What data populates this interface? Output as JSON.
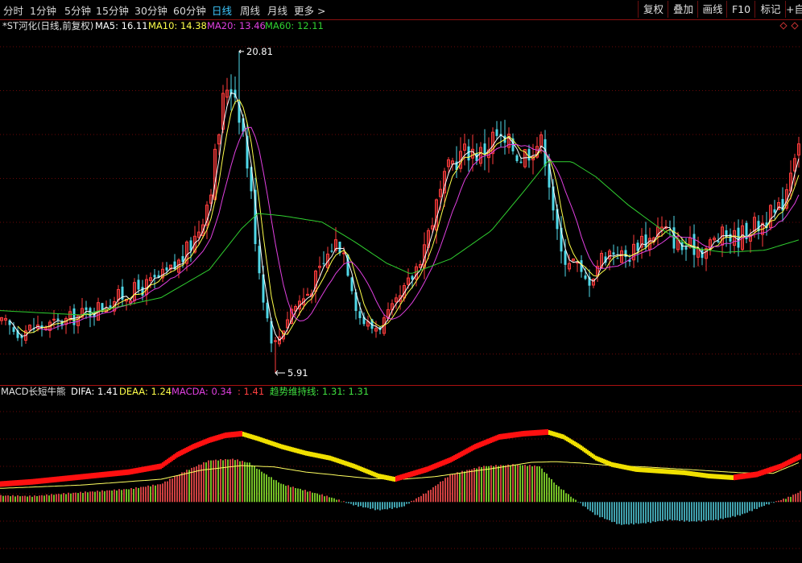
{
  "toolbar": {
    "periods": [
      "分时",
      "1分钟",
      "5分钟",
      "15分钟",
      "30分钟",
      "60分钟",
      "日线",
      "周线",
      "月线",
      "更多 >"
    ],
    "active_period": "日线",
    "buttons": [
      "复权",
      "叠加",
      "画线",
      "F10",
      "标记",
      "+自选"
    ]
  },
  "main_legend": {
    "stock": "*ST河化(日线,前复权)",
    "ma5": "MA5: 16.11",
    "ma10": "MA10: 14.38",
    "ma20": "MA20: 13.46",
    "ma60": "MA60: 12.11"
  },
  "annotations": {
    "high": "20.81",
    "low": "5.91"
  },
  "macd_legend": {
    "name": "MACD长短牛熊",
    "difa": "DIFA: 1.41",
    "deaa": "DEAA: 1.24",
    "macda": "MACDA: 0.34",
    "extra": ": 1.41",
    "trend": "趋势维持线: 1.31",
    "trend2": ": 1.31"
  },
  "colors": {
    "up": "#ff3c3c",
    "down": "#50d8e8",
    "ma5": "#ffffff",
    "ma10": "#ffff4a",
    "ma20": "#e040e0",
    "ma60": "#30d030",
    "macd_pos_up": "#ff5050",
    "macd_pos_down": "#90ee30",
    "macd_neg": "#50c8d8",
    "dif_up": "#ff1010",
    "dif_down": "#f0e000",
    "trend": "#ffff60"
  },
  "chart_data": [
    {
      "type": "candlestick",
      "title": "*ST河化(日线,前复权)",
      "ylim": [
        5.5,
        22.0
      ],
      "annotations": [
        {
          "label": "20.81",
          "value": 20.81
        },
        {
          "label": "5.91",
          "value": 5.91
        }
      ],
      "close_path_x": [
        0,
        10,
        20,
        40,
        60,
        80,
        100,
        120,
        140,
        160,
        180,
        200,
        215,
        230,
        245,
        260,
        270,
        280,
        290,
        300,
        310,
        320,
        330,
        340,
        350,
        360,
        380,
        400,
        415,
        425,
        435,
        445,
        460,
        470,
        480,
        490,
        500,
        515,
        530,
        545,
        560,
        575,
        585,
        595,
        605,
        615,
        625,
        635,
        645,
        655,
        665,
        675,
        685,
        695,
        705,
        715,
        725,
        735,
        745,
        755,
        765,
        775,
        785,
        795,
        805,
        815,
        825,
        835,
        845,
        855,
        865,
        875,
        885,
        895,
        905,
        915,
        925,
        935,
        945,
        955,
        965,
        975,
        985,
        995
      ],
      "close_path_y": [
        8.2,
        8.1,
        7.8,
        8.0,
        8.1,
        8.3,
        8.6,
        8.9,
        9.3,
        9.6,
        9.9,
        10.3,
        10.7,
        11.4,
        12.4,
        14.2,
        16.6,
        19.3,
        19.2,
        17.6,
        14.8,
        11.2,
        8.8,
        7.1,
        7.9,
        8.8,
        9.5,
        10.8,
        12.0,
        11.8,
        10.4,
        8.6,
        8.0,
        8.1,
        8.4,
        8.9,
        9.5,
        10.6,
        12.2,
        14.0,
        15.6,
        16.1,
        16.3,
        16.0,
        16.4,
        17.0,
        16.4,
        16.5,
        15.9,
        16.2,
        16.6,
        16.5,
        14.2,
        11.4,
        11.3,
        11.0,
        10.1,
        10.4,
        11.2,
        11.5,
        11.6,
        11.2,
        11.5,
        12.2,
        12.0,
        12.6,
        12.5,
        12.2,
        11.7,
        11.7,
        11.8,
        11.6,
        12.0,
        12.2,
        12.3,
        12.1,
        12.5,
        12.7,
        12.8,
        13.2,
        13.2,
        14.2,
        16.1,
        17.2
      ],
      "ma60_x": [
        0,
        100,
        200,
        260,
        300,
        320,
        350,
        400,
        440,
        480,
        510,
        560,
        610,
        650,
        680,
        710,
        740,
        780,
        820,
        860,
        900,
        950,
        995
      ],
      "ma60_y": [
        8.8,
        8.6,
        9.4,
        10.7,
        12.6,
        13.3,
        13.2,
        12.9,
        12.0,
        11.0,
        10.5,
        11.2,
        12.5,
        14.3,
        15.7,
        15.7,
        15.0,
        13.7,
        12.6,
        11.7,
        11.5,
        11.6,
        12.11
      ]
    },
    {
      "type": "macd",
      "title": "MACD长短牛熊",
      "ylim": [
        -1.8,
        3.2
      ],
      "dif_x": [
        0,
        40,
        80,
        120,
        160,
        200,
        220,
        240,
        260,
        280,
        300,
        320,
        350,
        380,
        410,
        440,
        470,
        490,
        510,
        530,
        560,
        590,
        620,
        650,
        680,
        700,
        720,
        740,
        760,
        790,
        820,
        850,
        880,
        910,
        940,
        970,
        995
      ],
      "dif_y": [
        0.55,
        0.62,
        0.72,
        0.82,
        0.92,
        1.1,
        1.45,
        1.7,
        1.9,
        2.05,
        2.1,
        1.95,
        1.7,
        1.5,
        1.35,
        1.1,
        0.8,
        0.7,
        0.85,
        1.0,
        1.3,
        1.7,
        2.0,
        2.1,
        2.15,
        2.0,
        1.7,
        1.35,
        1.15,
        1.0,
        0.95,
        0.9,
        0.8,
        0.75,
        0.85,
        1.1,
        1.41
      ],
      "dea_x": [
        0,
        100,
        200,
        250,
        300,
        340,
        380,
        420,
        460,
        500,
        540,
        580,
        620,
        660,
        690,
        720,
        760,
        800,
        840,
        880,
        920,
        960,
        995
      ],
      "dea_y": [
        0.42,
        0.52,
        0.7,
        0.98,
        1.12,
        1.08,
        0.92,
        0.82,
        0.72,
        0.7,
        0.78,
        0.92,
        1.06,
        1.22,
        1.24,
        1.2,
        1.12,
        1.08,
        1.02,
        0.96,
        0.9,
        0.88,
        1.24
      ],
      "hist_x": [
        0,
        40,
        80,
        120,
        160,
        200,
        230,
        260,
        290,
        310,
        330,
        350,
        380,
        410,
        440,
        470,
        500,
        530,
        560,
        600,
        640,
        670,
        690,
        710,
        740,
        770,
        800,
        830,
        860,
        890,
        920,
        950,
        980,
        995
      ],
      "hist_y": [
        0.2,
        0.18,
        0.26,
        0.33,
        0.4,
        0.55,
        0.95,
        1.28,
        1.32,
        1.2,
        0.85,
        0.55,
        0.35,
        0.15,
        -0.1,
        -0.25,
        -0.15,
        0.3,
        0.85,
        1.1,
        1.15,
        1.1,
        0.55,
        0.15,
        -0.4,
        -0.7,
        -0.65,
        -0.55,
        -0.6,
        -0.55,
        -0.4,
        -0.1,
        0.15,
        0.34
      ]
    }
  ]
}
